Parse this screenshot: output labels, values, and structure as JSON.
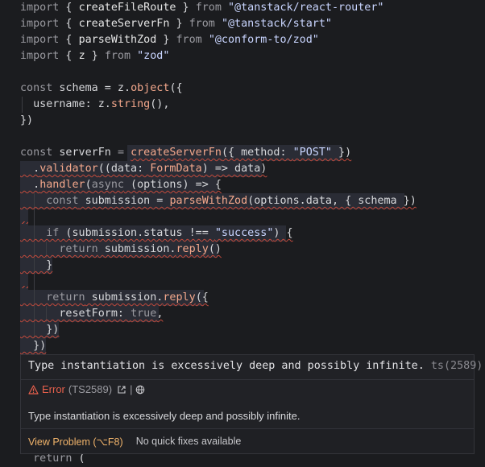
{
  "code": {
    "l1": {
      "kw": "import",
      "open": " { ",
      "name": "createFileRoute",
      "close": " } ",
      "from": "from",
      "str": "\"@tanstack/react-router\""
    },
    "l2": {
      "kw": "import",
      "open": " { ",
      "name": "createServerFn",
      "close": " } ",
      "from": "from",
      "str": "\"@tanstack/start\""
    },
    "l3": {
      "kw": "import",
      "open": " { ",
      "name": "parseWithZod",
      "close": " } ",
      "from": "from",
      "str": "\"@conform-to/zod\""
    },
    "l4": {
      "kw": "import",
      "open": " { ",
      "name": "z",
      "close": " } ",
      "from": "from",
      "str": "\"zod\""
    },
    "l6": {
      "kw": "const",
      "name": " schema = z.",
      "fn": "object",
      "rest": "({"
    },
    "l7": {
      "prop": "  username: z.",
      "fn": "string",
      "rest": "(),"
    },
    "l8": {
      "text": "})"
    },
    "l10": {
      "kw": "const",
      "name": " serverFn ",
      "eq": "= ",
      "fn": "createServerFn",
      "rest": "({ method: ",
      "str": "\"POST\"",
      "end": " })"
    },
    "l11": {
      "pre": "  .",
      "fn": "validator",
      "rest": "((data: ",
      "ty": "FormData",
      "end": ") => data)"
    },
    "l12": {
      "pre": "  .",
      "fn": "handler",
      "rest": "(",
      "kw": "async",
      "end": " (options) => {"
    },
    "l13": {
      "kw": "    const",
      "name": " submission = ",
      "fn": "parseWithZod",
      "rest": "(options.data, { schema })"
    },
    "l15": {
      "kw": "    if",
      "rest": " (submission.status !== ",
      "str": "\"success\"",
      "end": ") {"
    },
    "l16": {
      "kw": "      return",
      "rest": " submission.",
      "fn": "reply",
      "end": "()"
    },
    "l17": {
      "text": "    }"
    },
    "l19": {
      "kw": "    return",
      "rest": " submission.",
      "fn": "reply",
      "end": "({"
    },
    "l20": {
      "pre": "      resetForm: ",
      "kw": "true",
      "end": ","
    },
    "l21": {
      "text": "    })"
    },
    "l22": {
      "text": "  })"
    },
    "l24": {
      "kw": "  return",
      "rest": " ("
    }
  },
  "hover": {
    "signature": "Type instantiation is excessively deep and possibly infinite.",
    "signature_code": "ts(2589)",
    "error_label": "Error",
    "error_code": "(TS2589)",
    "separator": "|",
    "message": "Type instantiation is excessively deep and possibly infinite.",
    "view_problem": "View Problem (⌥F8)",
    "no_fixes": "No quick fixes available"
  },
  "colors": {
    "error": "#e8604c",
    "accent": "#f0b36a",
    "background": "#1b1c1f"
  }
}
